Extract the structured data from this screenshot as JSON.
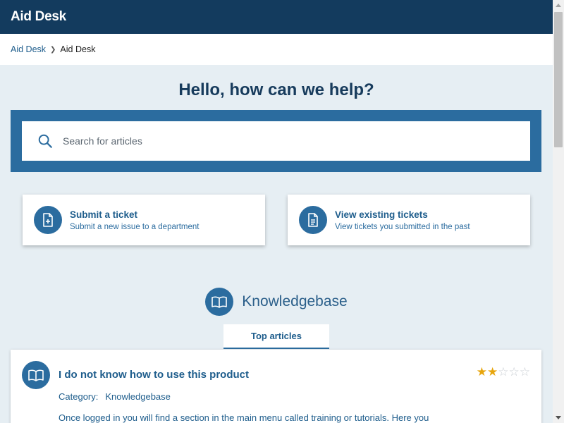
{
  "header": {
    "title": "Aid Desk"
  },
  "breadcrumb": {
    "items": [
      "Aid Desk",
      "Aid Desk"
    ]
  },
  "hero": {
    "title": "Hello, how can we help?"
  },
  "search": {
    "placeholder": "Search for articles",
    "value": ""
  },
  "cards": [
    {
      "title": "Submit a ticket",
      "subtitle": "Submit a new issue to a department",
      "icon": "file-plus-icon"
    },
    {
      "title": "View existing tickets",
      "subtitle": "View tickets you submitted in the past",
      "icon": "file-text-icon"
    }
  ],
  "knowledgebase": {
    "title": "Knowledgebase",
    "icon": "open-book-icon"
  },
  "tabs": {
    "top_articles": "Top articles"
  },
  "article": {
    "title": "I do not know how to use this product",
    "rating": 2,
    "rating_max": 5,
    "category_label": "Category:",
    "category_value": "Knowledgebase",
    "excerpt": "Once logged in you will find a section in the main menu called training or tutorials. Here you"
  },
  "colors": {
    "header": "#133b5e",
    "accent": "#2b6c9f",
    "star": "#e7a50d",
    "background": "#e6eef3"
  }
}
